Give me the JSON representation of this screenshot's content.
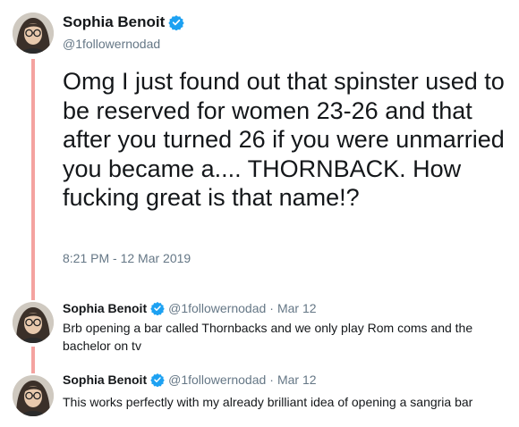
{
  "main_tweet": {
    "name": "Sophia Benoit",
    "handle": "@1followernodad",
    "text": "Omg I just found out that spinster used to be reserved for women 23-26 and that after you turned 26 if you were unmarried you became a.... THORNBACK. How fucking great is that name!?",
    "timestamp": "8:21 PM - 12 Mar 2019"
  },
  "replies": [
    {
      "name": "Sophia Benoit",
      "handle": "@1followernodad",
      "separator": "·",
      "date": "Mar 12",
      "text": "Brb opening a bar called Thornbacks and we only play Rom coms and the bachelor on tv"
    },
    {
      "name": "Sophia Benoit",
      "handle": "@1followernodad",
      "separator": "·",
      "date": "Mar 12",
      "text": "This works perfectly with my already brilliant idea of opening a sangria bar"
    }
  ],
  "colors": {
    "thread_line": "#f4a3a0",
    "verified": "#1da1f2",
    "secondary_text": "#657786"
  },
  "icons": [
    "avatar",
    "verified-badge-icon"
  ]
}
